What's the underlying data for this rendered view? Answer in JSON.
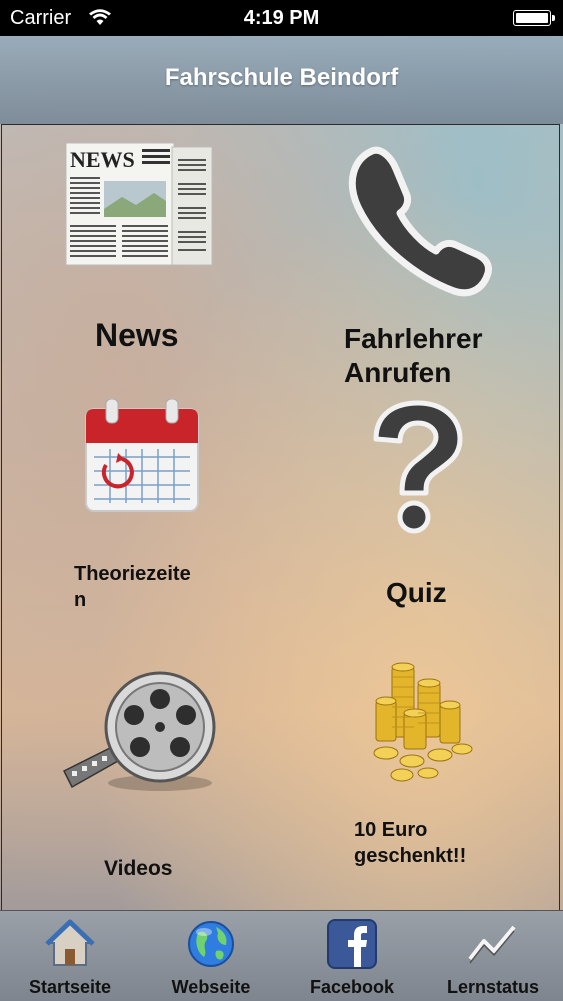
{
  "status_bar": {
    "carrier": "Carrier",
    "time": "4:19 PM"
  },
  "nav": {
    "title": "Fahrschule Beindorf"
  },
  "tiles": {
    "news": {
      "label": "News",
      "icon": "newspaper-icon"
    },
    "call": {
      "label_line1": "Fahrlehrer",
      "label_line2": "Anrufen",
      "icon": "phone-icon"
    },
    "theory": {
      "label_line1": "Theoriezeite",
      "label_line2": "n",
      "icon": "calendar-icon"
    },
    "quiz": {
      "label": "Quiz",
      "icon": "question-mark-icon"
    },
    "videos": {
      "label": "Videos",
      "icon": "film-reel-icon"
    },
    "euro": {
      "label_line1": "10 Euro",
      "label_line2": "geschenkt!!",
      "icon": "coins-icon"
    }
  },
  "tab_bar": {
    "tabs": [
      {
        "label": "Startseite",
        "icon": "home-icon"
      },
      {
        "label": "Webseite",
        "icon": "globe-icon"
      },
      {
        "label": "Facebook",
        "icon": "facebook-icon"
      },
      {
        "label": "Lernstatus",
        "icon": "chart-line-icon"
      }
    ]
  },
  "colors": {
    "calendar_red": "#c8242a",
    "facebook_blue": "#3b5998"
  }
}
